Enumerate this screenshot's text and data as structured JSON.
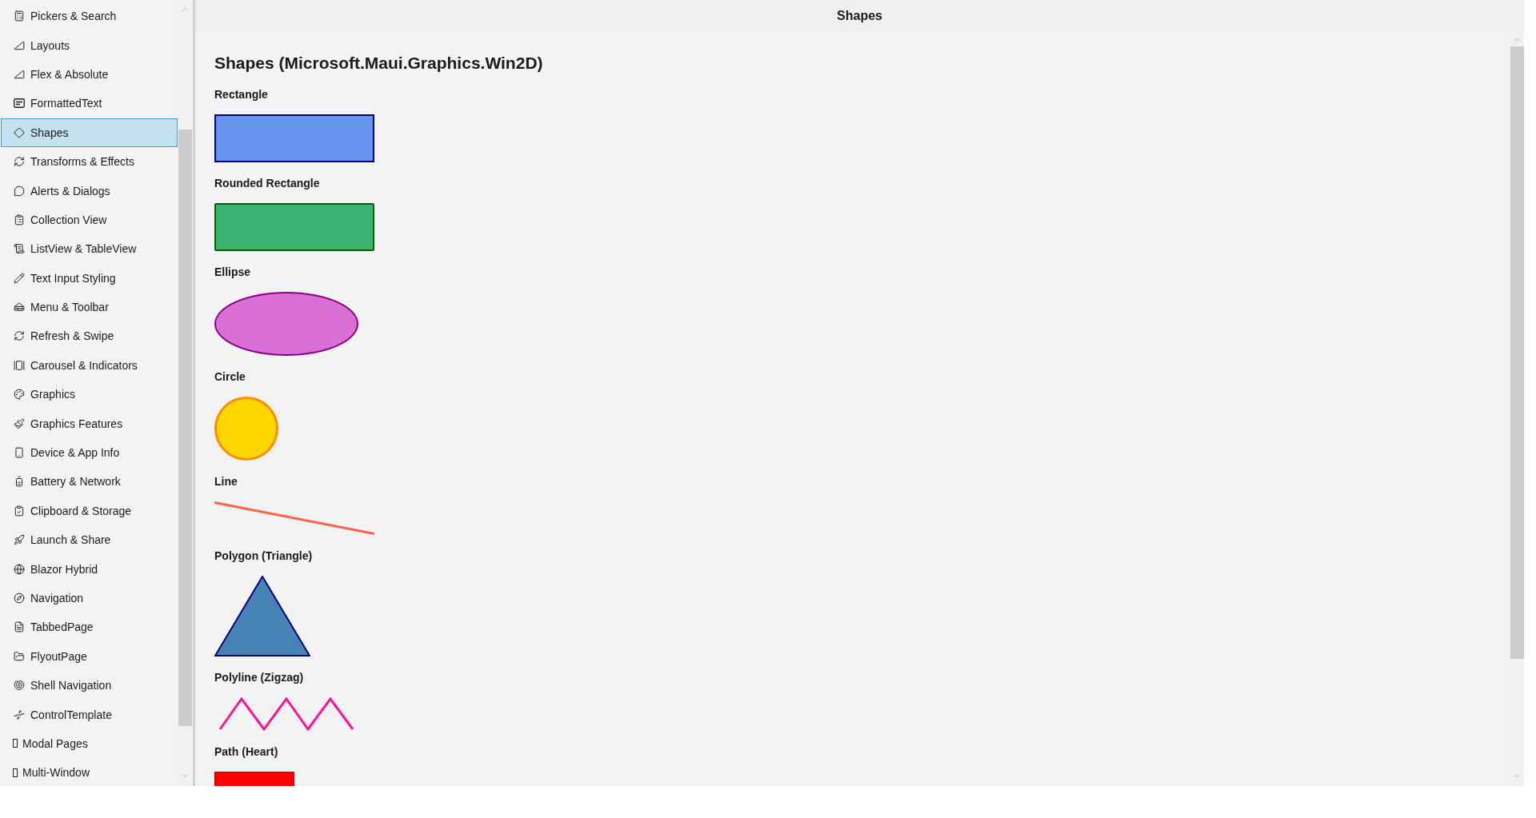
{
  "sidebar": {
    "items": [
      {
        "label": "Pickers & Search",
        "selected": false
      },
      {
        "label": "Layouts",
        "selected": false
      },
      {
        "label": "Flex & Absolute",
        "selected": false
      },
      {
        "label": "FormattedText",
        "selected": false
      },
      {
        "label": "Shapes",
        "selected": true
      },
      {
        "label": "Transforms & Effects",
        "selected": false
      },
      {
        "label": "Alerts & Dialogs",
        "selected": false
      },
      {
        "label": "Collection View",
        "selected": false
      },
      {
        "label": "ListView & TableView",
        "selected": false
      },
      {
        "label": "Text Input Styling",
        "selected": false
      },
      {
        "label": "Menu & Toolbar",
        "selected": false
      },
      {
        "label": "Refresh & Swipe",
        "selected": false
      },
      {
        "label": "Carousel & Indicators",
        "selected": false
      },
      {
        "label": "Graphics",
        "selected": false
      },
      {
        "label": "Graphics Features",
        "selected": false
      },
      {
        "label": "Device & App Info",
        "selected": false
      },
      {
        "label": "Battery & Network",
        "selected": false
      },
      {
        "label": "Clipboard & Storage",
        "selected": false
      },
      {
        "label": "Launch & Share",
        "selected": false
      },
      {
        "label": "Blazor Hybrid",
        "selected": false
      },
      {
        "label": "Navigation",
        "selected": false
      },
      {
        "label": "TabbedPage",
        "selected": false
      },
      {
        "label": "FlyoutPage",
        "selected": false
      },
      {
        "label": "Shell Navigation",
        "selected": false
      },
      {
        "label": "ControlTemplate",
        "selected": false
      },
      {
        "label": "Modal Pages",
        "selected": false
      },
      {
        "label": "Multi-Window",
        "selected": false
      }
    ]
  },
  "page": {
    "title": "Shapes"
  },
  "content": {
    "heading": "Shapes (Microsoft.Maui.Graphics.Win2D)",
    "shapes": [
      {
        "label": "Rectangle",
        "kind": "rectangle",
        "color": "#6495ed"
      },
      {
        "label": "Rounded Rectangle",
        "kind": "roundrect",
        "color": "#3cb371"
      },
      {
        "label": "Ellipse",
        "kind": "ellipse",
        "color": "#da70d6"
      },
      {
        "label": "Circle",
        "kind": "circle",
        "color": "#ffd700"
      },
      {
        "label": "Line",
        "kind": "line",
        "color": "#ff6347"
      },
      {
        "label": "Polygon (Triangle)",
        "kind": "polygon",
        "color": "#4682b4"
      },
      {
        "label": "Polyline (Zigzag)",
        "kind": "polyline",
        "color": "#ff1493"
      },
      {
        "label": "Path (Heart)",
        "kind": "path",
        "color": "#ff0000"
      }
    ]
  }
}
